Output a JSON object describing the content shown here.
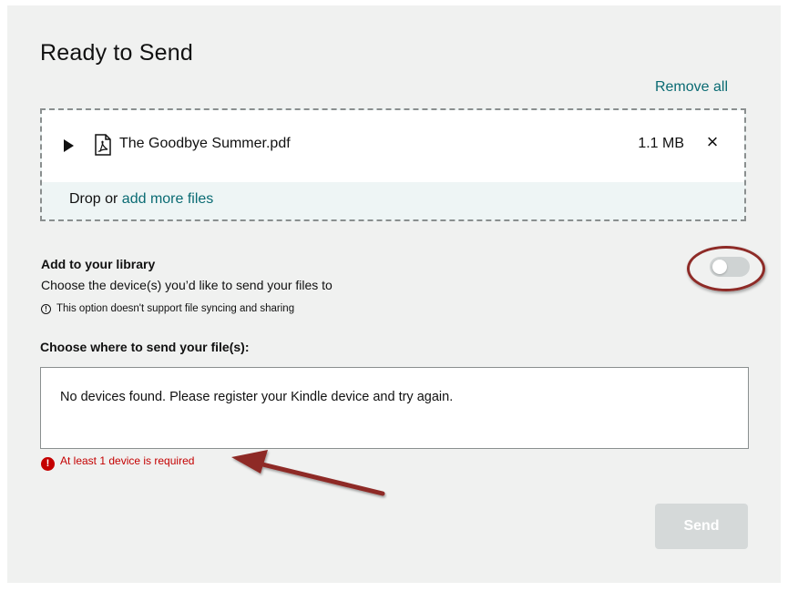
{
  "page": {
    "title": "Ready to Send",
    "remove_all": "Remove all"
  },
  "file": {
    "name": "The Goodbye Summer.pdf",
    "size": "1.1 MB",
    "remove_glyph": "×"
  },
  "dropzone": {
    "prefix": "Drop or ",
    "link": "add more files"
  },
  "library": {
    "title": "Add to your library",
    "subtitle": "Choose the device(s) you’d like to send your files to",
    "note": "This option doesn't support file syncing and sharing",
    "toggle_on": false
  },
  "devices": {
    "title": "Choose where to send your file(s):",
    "empty_message": "No devices found. Please register your Kindle device and try again.",
    "error": "At least 1 device is required"
  },
  "actions": {
    "send": "Send"
  },
  "colors": {
    "link": "#0a6b73",
    "error": "#c40000",
    "annotation": "#8e2b27",
    "panel": "#f0f1f0"
  }
}
